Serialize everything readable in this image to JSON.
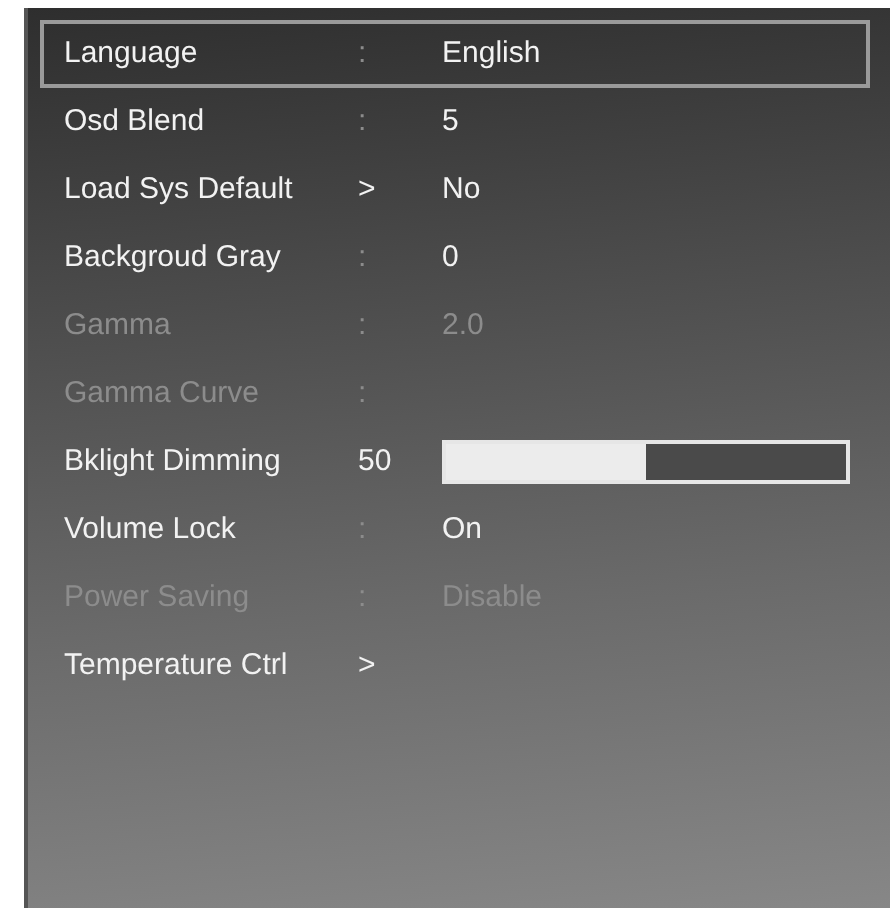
{
  "menu": {
    "items": [
      {
        "kind": "option",
        "label": "Language",
        "separator": ":",
        "value": "English",
        "selected": true,
        "disabled": false
      },
      {
        "kind": "option",
        "label": "Osd Blend",
        "separator": ":",
        "value": "5",
        "selected": false,
        "disabled": false
      },
      {
        "kind": "option",
        "label": "Load Sys Default",
        "separator": ">",
        "value": "No",
        "selected": false,
        "disabled": false
      },
      {
        "kind": "option",
        "label": "Backgroud Gray",
        "separator": ":",
        "value": "0",
        "selected": false,
        "disabled": false
      },
      {
        "kind": "option",
        "label": "Gamma",
        "separator": ":",
        "value": "2.0",
        "selected": false,
        "disabled": true
      },
      {
        "kind": "option",
        "label": "Gamma Curve",
        "separator": ":",
        "selected": false,
        "disabled": true
      },
      {
        "kind": "slider",
        "label": "Bklight Dimming",
        "reading": "50",
        "level": 0.5,
        "selected": false,
        "disabled": false
      },
      {
        "kind": "option",
        "label": "Volume Lock",
        "separator": ":",
        "value": "On",
        "selected": false,
        "disabled": false
      },
      {
        "kind": "option",
        "label": "Power Saving",
        "separator": ":",
        "value": "Disable",
        "selected": false,
        "disabled": true
      },
      {
        "kind": "option",
        "label": "Temperature Ctrl",
        "separator": ">",
        "selected": false,
        "disabled": false
      }
    ]
  }
}
